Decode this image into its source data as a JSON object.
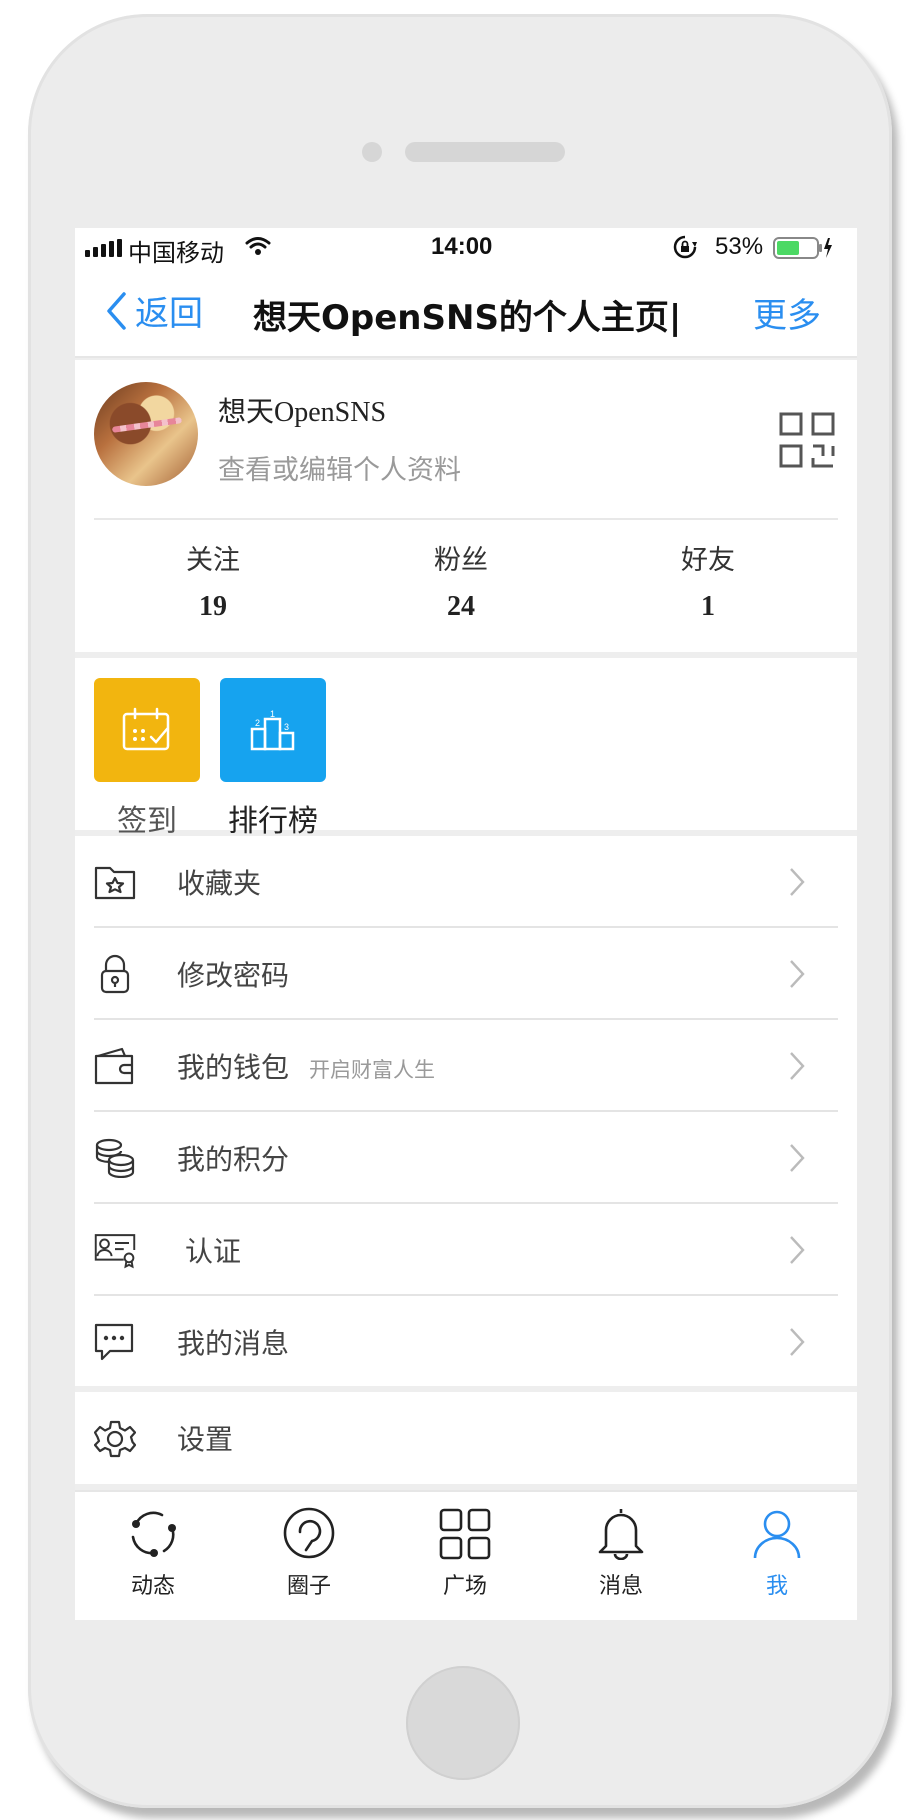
{
  "status_bar": {
    "carrier": "中国移动",
    "time": "14:00",
    "battery": "53%"
  },
  "nav": {
    "back_label": "返回",
    "title": "想天OpenSNS的个人主页|",
    "more_label": "更多"
  },
  "profile": {
    "name": "想天OpenSNS",
    "subtitle": "查看或编辑个人资料",
    "stats": [
      {
        "label": "关注",
        "value": "19"
      },
      {
        "label": "粉丝",
        "value": "24"
      },
      {
        "label": "好友",
        "value": "1"
      }
    ]
  },
  "quick_actions": [
    {
      "label": "签到",
      "icon": "calendar-check-icon",
      "color": "#f2b50f"
    },
    {
      "label": "排行榜",
      "icon": "podium-icon",
      "color": "#16a3ef"
    }
  ],
  "menu": [
    {
      "label": "收藏夹",
      "note": "",
      "icon": "star-folder-icon"
    },
    {
      "label": "修改密码",
      "note": "",
      "icon": "lock-icon"
    },
    {
      "label": "我的钱包",
      "note": "开启财富人生",
      "icon": "wallet-icon"
    },
    {
      "label": "我的积分",
      "note": "",
      "icon": "coins-icon"
    },
    {
      "label": "认证",
      "note": "",
      "icon": "id-card-icon"
    },
    {
      "label": "我的消息",
      "note": "",
      "icon": "chat-icon"
    }
  ],
  "settings": {
    "label": "设置",
    "icon": "gear-icon"
  },
  "tabs": [
    {
      "label": "动态",
      "icon": "refresh-icon",
      "active": false
    },
    {
      "label": "圈子",
      "icon": "circle-icon",
      "active": false
    },
    {
      "label": "广场",
      "icon": "grid-icon",
      "active": false
    },
    {
      "label": "消息",
      "icon": "bell-icon",
      "active": false
    },
    {
      "label": "我",
      "icon": "person-icon",
      "active": true
    }
  ],
  "colors": {
    "accent": "#2a8ef0",
    "checkin": "#f2b50f",
    "ranking": "#16a3ef"
  }
}
